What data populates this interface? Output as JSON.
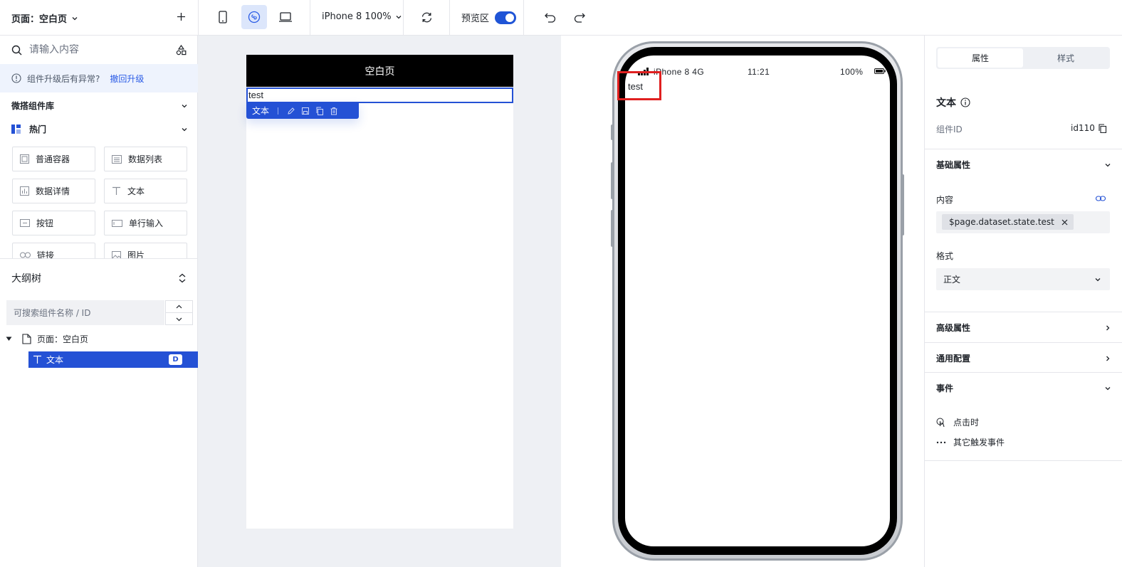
{
  "topbar": {
    "page_label": "页面：空白页",
    "device_label": "iPhone 8 100%",
    "preview_label": "预览区"
  },
  "left": {
    "search_placeholder": "请输入内容",
    "notice_text": "组件升级后有异常?",
    "notice_link": "撤回升级",
    "library_title": "微搭组件库",
    "hot_title": "热门",
    "components": [
      "普通容器",
      "数据列表",
      "数据详情",
      "文本",
      "按钮",
      "单行输入",
      "链接",
      "图片"
    ],
    "outline_title": "大纲树",
    "outline_search_placeholder": "可搜索组件名称 / ID",
    "tree": {
      "page": "页面：空白页",
      "text": "文本",
      "badge": "D"
    }
  },
  "canvas": {
    "nav_title": "空白页",
    "text_value": "test",
    "toolbar_label": "文本"
  },
  "preview": {
    "carrier": "iPhone 8  4G",
    "time": "11:21",
    "battery": "100%",
    "text_value": "test"
  },
  "right": {
    "tab_props": "属性",
    "tab_style": "样式",
    "component_name": "文本",
    "id_label": "组件ID",
    "id_value": "id110",
    "basic_section": "基础属性",
    "content_label": "内容",
    "content_tag": "$page.dataset.state.test",
    "format_label": "格式",
    "format_value": "正文",
    "advanced_section": "高级属性",
    "common_section": "通用配置",
    "events_section": "事件",
    "event_click": "点击时",
    "event_other": "其它触发事件"
  },
  "colors": {
    "accent": "#2451d5",
    "highlight": "#e02020"
  }
}
